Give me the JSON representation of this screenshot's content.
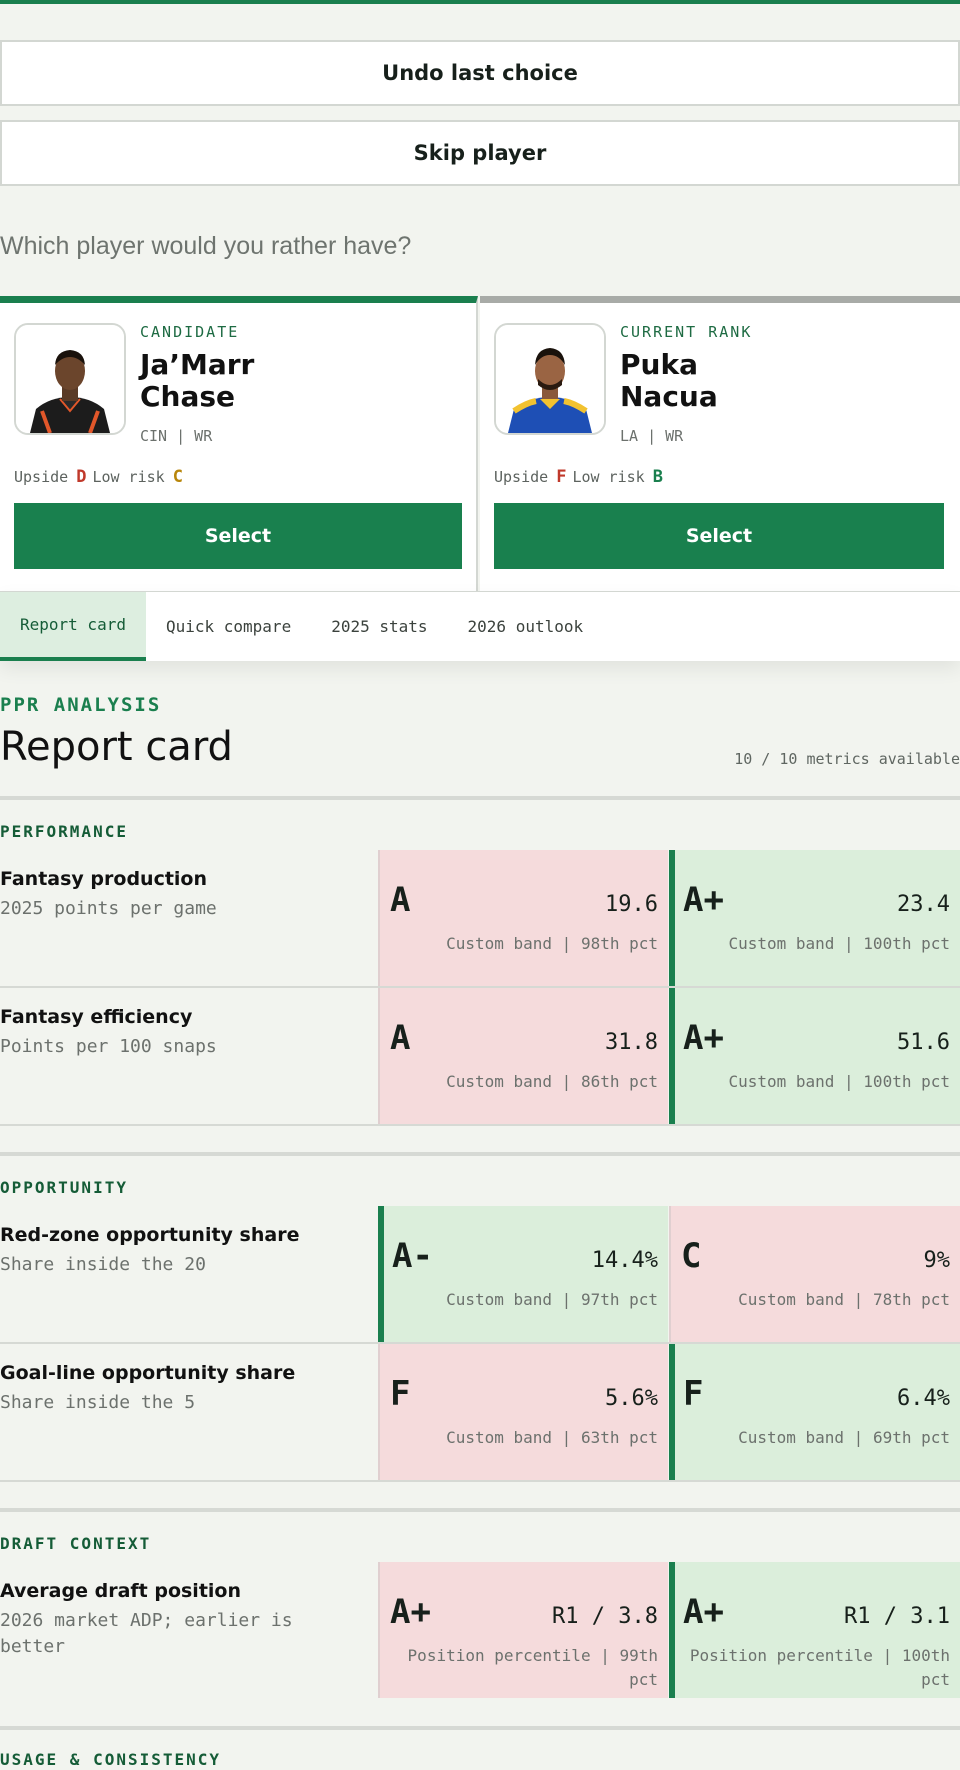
{
  "actions": {
    "undo_label": "Undo last choice",
    "skip_label": "Skip player"
  },
  "question": "Which player would you rather have?",
  "players": [
    {
      "role": "CANDIDATE",
      "name": "Ja’Marr Chase",
      "name_line1": "Ja’Marr",
      "name_line2": "Chase",
      "team": "CIN | WR",
      "upside_label": "Upside",
      "upside_grade": "D",
      "risk_label": "Low risk",
      "risk_grade": "C",
      "select_label": "Select"
    },
    {
      "role": "CURRENT RANK",
      "name": "Puka Nacua",
      "name_line1": "Puka",
      "name_line2": "Nacua",
      "team": "LA | WR",
      "upside_label": "Upside",
      "upside_grade": "F",
      "risk_label": "Low risk",
      "risk_grade": "B",
      "select_label": "Select"
    }
  ],
  "tabs": [
    "Report card",
    "Quick compare",
    "2025 stats",
    "2026 outlook"
  ],
  "report": {
    "kicker": "PPR ANALYSIS",
    "title": "Report card",
    "metrics_available": "10 / 10 metrics available"
  },
  "sections": [
    {
      "label": "PERFORMANCE",
      "rows": [
        {
          "title": "Fantasy production",
          "subtitle": "2025 points per game",
          "left": {
            "grade": "A",
            "value": "19.6",
            "meta": "Custom band | 98th pct"
          },
          "right": {
            "grade": "A+",
            "value": "23.4",
            "meta": "Custom band | 100th pct"
          }
        },
        {
          "title": "Fantasy efficiency",
          "subtitle": "Points per 100 snaps",
          "left": {
            "grade": "A",
            "value": "31.8",
            "meta": "Custom band | 86th pct"
          },
          "right": {
            "grade": "A+",
            "value": "51.6",
            "meta": "Custom band | 100th pct"
          }
        }
      ]
    },
    {
      "label": "OPPORTUNITY",
      "rows": [
        {
          "title": "Red-zone opportunity share",
          "subtitle": "Share inside the 20",
          "left": {
            "grade": "A-",
            "value": "14.4%",
            "meta": "Custom band | 97th pct"
          },
          "right": {
            "grade": "C",
            "value": "9%",
            "meta": "Custom band | 78th pct"
          }
        },
        {
          "title": "Goal-line opportunity share",
          "subtitle": "Share inside the 5",
          "left": {
            "grade": "F",
            "value": "5.6%",
            "meta": "Custom band | 63th pct"
          },
          "right": {
            "grade": "F",
            "value": "6.4%",
            "meta": "Custom band | 69th pct"
          }
        }
      ]
    },
    {
      "label": "DRAFT CONTEXT",
      "rows": [
        {
          "title": "Average draft position",
          "subtitle": "2026 market ADP; earlier is better",
          "left": {
            "grade": "A+",
            "value": "R1 / 3.8",
            "meta": "Position percentile | 99th pct"
          },
          "right": {
            "grade": "A+",
            "value": "R1 / 3.1",
            "meta": "Position percentile | 100th pct"
          }
        }
      ]
    },
    {
      "label": "USAGE & CONSISTENCY",
      "rows": []
    }
  ],
  "colors": {
    "accent": "#1a7f4e",
    "win_bg": "#dbeedb",
    "lose_bg": "#f5dbdc",
    "grade_red": "#c0392b",
    "grade_amber": "#b8860b"
  }
}
